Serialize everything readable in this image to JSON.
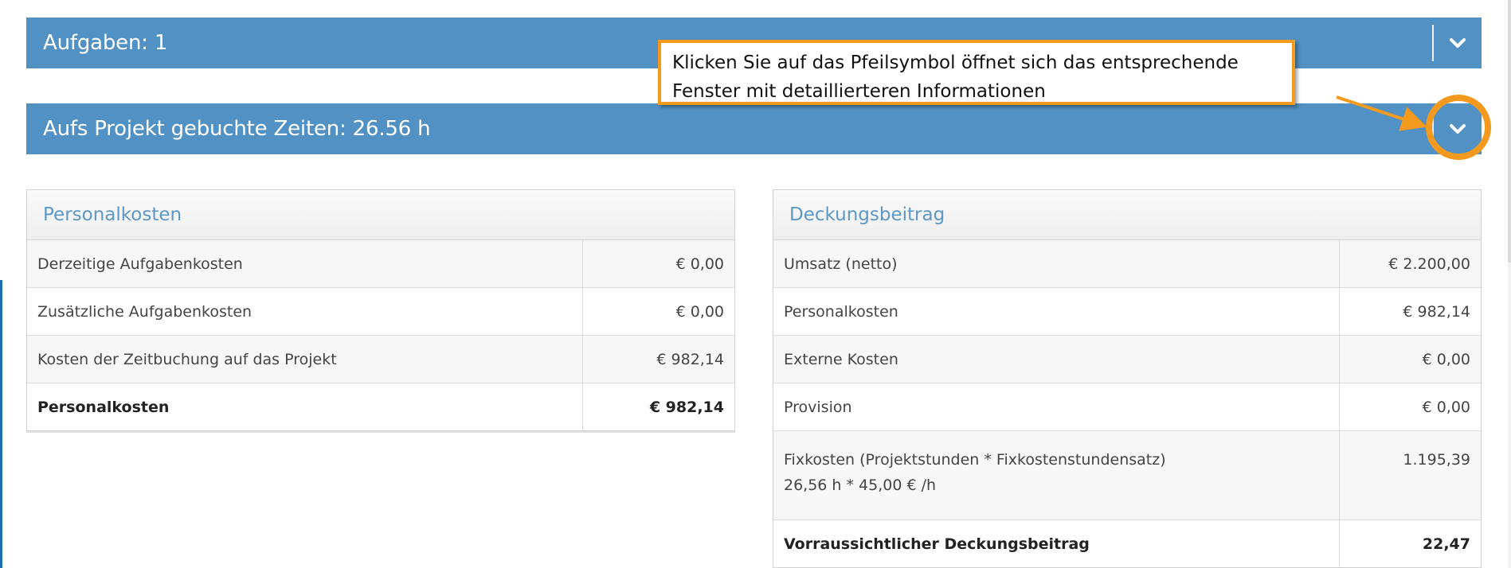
{
  "accordions": [
    {
      "title": "Aufgaben: 1",
      "toggle_icon": "chevron-down-icon"
    },
    {
      "title": "Aufs Projekt gebuchte Zeiten: 26.56 h",
      "toggle_icon": "chevron-down-icon"
    }
  ],
  "personalkosten_panel": {
    "title": "Personalkosten",
    "rows": [
      {
        "label": "Derzeitige Aufgabenkosten",
        "value": "€ 0,00"
      },
      {
        "label": "Zusätzliche Aufgabenkosten",
        "value": "€ 0,00"
      },
      {
        "label": "Kosten der Zeitbuchung auf das Projekt",
        "value": "€ 982,14"
      }
    ],
    "total": {
      "label": "Personalkosten",
      "value": "€ 982,14"
    }
  },
  "deckungsbeitrag_panel": {
    "title": "Deckungsbeitrag",
    "rows": [
      {
        "label": "Umsatz (netto)",
        "value": "€ 2.200,00"
      },
      {
        "label": "Personalkosten",
        "value": "€ 982,14"
      },
      {
        "label": "Externe Kosten",
        "value": "€ 0,00"
      },
      {
        "label": "Provision",
        "value": "€ 0,00"
      },
      {
        "label": "Fixkosten (Projektstunden * Fixkostenstundensatz)",
        "sublabel": "26,56 h * 45,00 € /h",
        "value": "1.195,39"
      }
    ],
    "total": {
      "label": "Vorraussichtlicher Deckungsbeitrag",
      "value": "22,47"
    }
  },
  "callout": {
    "line1": "Klicken Sie auf das Pfeilsymbol öffnet sich das entsprechende",
    "line2": "Fenster mit detaillierteren Informationen"
  },
  "colors": {
    "accordion_bg": "#5291c3",
    "panel_title": "#5d97c6",
    "callout_border": "#f39a1e"
  }
}
